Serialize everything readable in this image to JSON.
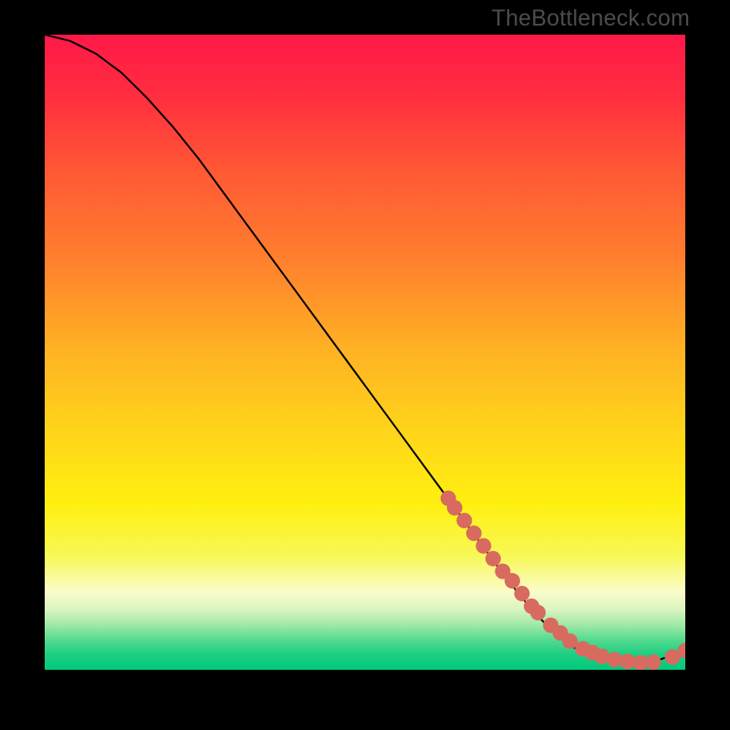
{
  "watermark": "TheBottleneck.com",
  "chart_data": {
    "type": "line",
    "title": "",
    "xlabel": "",
    "ylabel": "",
    "xlim": [
      0,
      100
    ],
    "ylim": [
      0,
      100
    ],
    "curve": {
      "x": [
        0,
        4,
        8,
        12,
        16,
        20,
        24,
        28,
        32,
        36,
        40,
        44,
        48,
        52,
        56,
        60,
        64,
        68,
        72,
        76,
        80,
        84,
        88,
        92,
        96,
        100
      ],
      "y": [
        100,
        99,
        97,
        94,
        90,
        85.5,
        80.5,
        75,
        69.5,
        64,
        58.5,
        53,
        47.5,
        42,
        36.5,
        31,
        25.5,
        20,
        14.5,
        9.5,
        5.3,
        2.6,
        1.3,
        1.0,
        1.6,
        3.0
      ]
    },
    "markers": {
      "x": [
        63,
        64,
        65.5,
        67,
        68.5,
        70,
        71.5,
        73,
        74.5,
        76,
        77,
        79,
        80.5,
        82,
        84,
        85.5,
        87,
        89,
        91,
        93,
        95,
        98,
        100
      ],
      "y": [
        27,
        25.5,
        23.5,
        21.5,
        19.5,
        17.5,
        15.5,
        14,
        12,
        10,
        9,
        7,
        5.8,
        4.5,
        3.3,
        2.7,
        2.1,
        1.6,
        1.3,
        1.1,
        1.2,
        2.0,
        3.0
      ]
    },
    "gradient_stops": [
      {
        "offset": 0.0,
        "color": "#ff1848"
      },
      {
        "offset": 0.1,
        "color": "#ff2f3f"
      },
      {
        "offset": 0.22,
        "color": "#ff5a34"
      },
      {
        "offset": 0.35,
        "color": "#ff7e2e"
      },
      {
        "offset": 0.5,
        "color": "#ffb323"
      },
      {
        "offset": 0.62,
        "color": "#ffd31a"
      },
      {
        "offset": 0.74,
        "color": "#fff010"
      },
      {
        "offset": 0.82,
        "color": "#f8f855"
      },
      {
        "offset": 0.878,
        "color": "#fafccb"
      },
      {
        "offset": 0.905,
        "color": "#d9f4c0"
      },
      {
        "offset": 0.93,
        "color": "#9de8a5"
      },
      {
        "offset": 0.955,
        "color": "#4fd98e"
      },
      {
        "offset": 0.975,
        "color": "#1ecf83"
      },
      {
        "offset": 1.0,
        "color": "#00c97d"
      }
    ],
    "marker_color": "#d86a5f",
    "curve_color": "#000000"
  }
}
